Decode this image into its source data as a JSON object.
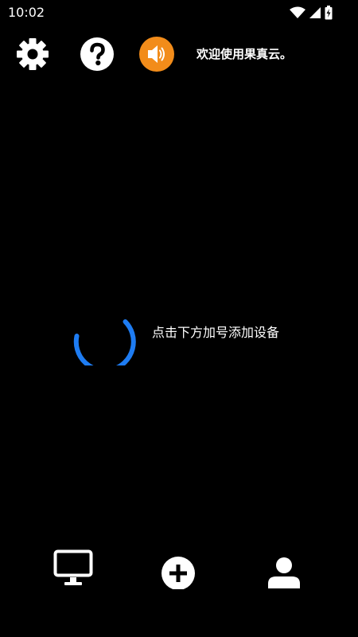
{
  "status_bar": {
    "time": "10:02",
    "icons": [
      "wifi-icon",
      "cell-signal-icon",
      "battery-charging-icon"
    ]
  },
  "toolbar": {
    "icons": [
      "gear-icon",
      "help-icon",
      "speaker-icon"
    ],
    "speaker_color": "#F28C1A",
    "welcome_text": "欢迎使用果真云。"
  },
  "main": {
    "loading_color": "#1E7CF2",
    "hint_text": "点击下方加号添加设备"
  },
  "bottom_nav": {
    "items": [
      "monitor-icon",
      "add-circle-icon",
      "person-icon"
    ]
  }
}
